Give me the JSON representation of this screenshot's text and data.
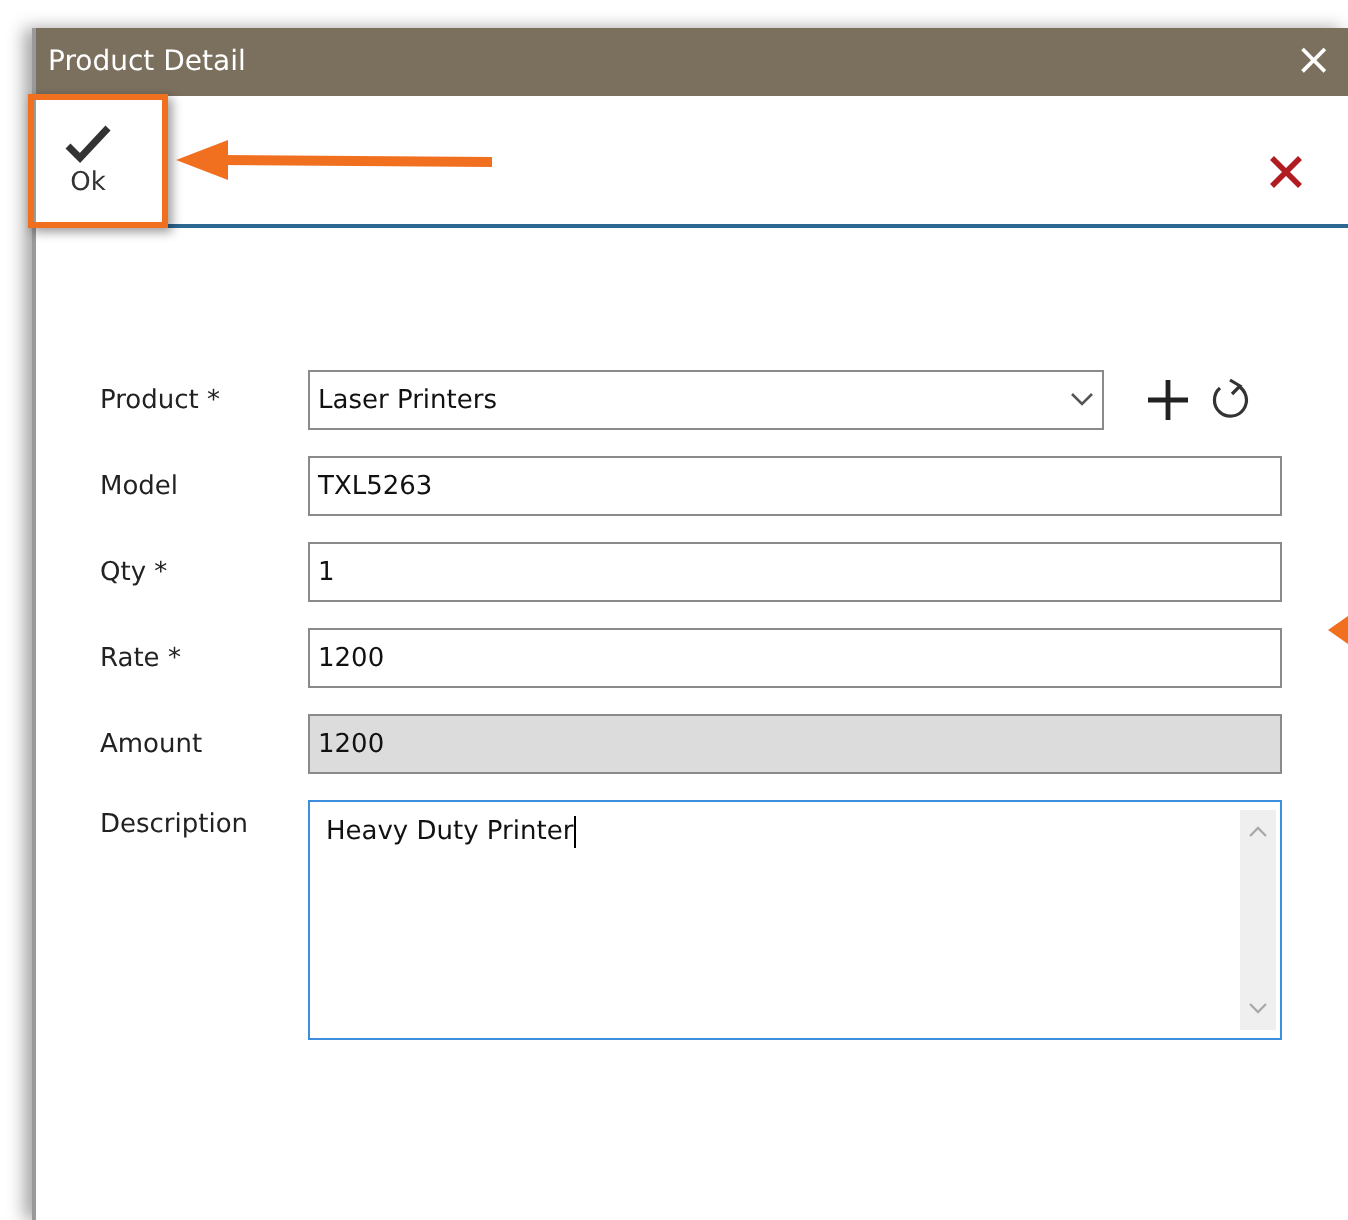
{
  "window": {
    "title": "Product Detail",
    "close_glyph": "×"
  },
  "toolbar": {
    "ok_label": "Ok"
  },
  "fields": [
    {
      "label": "Product *",
      "value": "Laser Printers",
      "kind": "dropdown",
      "focused": false
    },
    {
      "label": "Model",
      "value": "TXL5263",
      "kind": "text",
      "focused": false
    },
    {
      "label": "Qty *",
      "value": "1",
      "kind": "text",
      "focused": false
    },
    {
      "label": "Rate *",
      "value": "1200",
      "kind": "text",
      "focused": false
    },
    {
      "label": "Amount",
      "value": "1200",
      "kind": "readonly",
      "focused": false
    },
    {
      "label": "Description",
      "value": "Heavy Duty Printer",
      "kind": "textarea",
      "focused": true
    }
  ]
}
